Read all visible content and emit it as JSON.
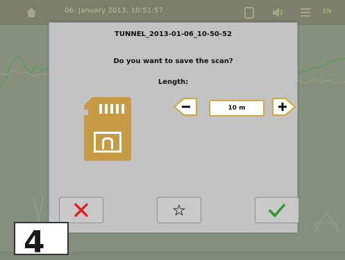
{
  "topbar": {
    "datetime": "06. January 2013, 10:51:57",
    "language": "EN",
    "icons": [
      "home-icon",
      "battery-icon",
      "volume-icon",
      "menu-icon"
    ]
  },
  "dialog": {
    "title": "TUNNEL_2013-01-06_10-50-52",
    "question": "Do you want to save the scan?",
    "length_label": "Length:",
    "length_value": "10 m",
    "minus_symbol": "−",
    "plus_symbol": "+",
    "buttons": {
      "cancel": "cancel-icon",
      "favorite": "star-icon",
      "confirm": "checkmark-icon"
    }
  },
  "step_label": "4",
  "colors": {
    "accent_gold": "#d4a843",
    "cancel_red": "#e0201f",
    "confirm_green": "#2e9a2c",
    "dialog_bg": "#c3c3c3"
  }
}
